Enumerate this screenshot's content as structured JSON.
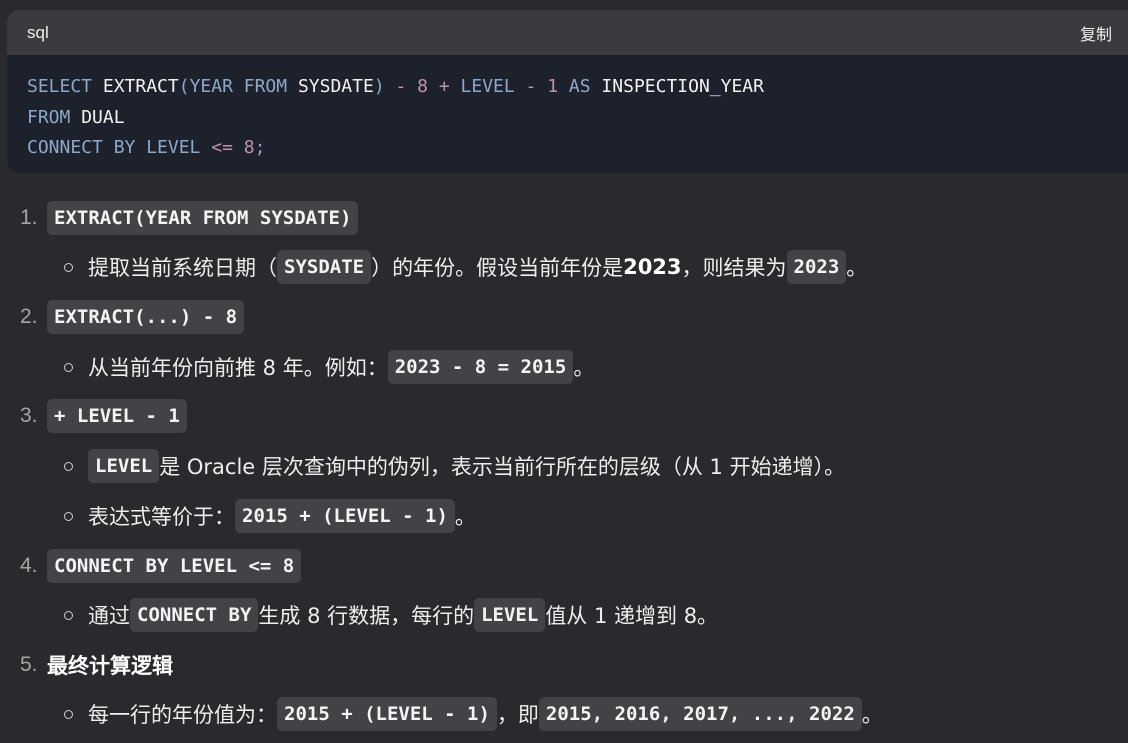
{
  "code_block": {
    "language": "sql",
    "copy_label": "复制",
    "line1": {
      "t1": "SELECT",
      "t2": " EXTRACT",
      "t3": "(",
      "t4": "YEAR FROM",
      "t5": " SYSDATE",
      "t6": ")",
      "t7": " - 8 + ",
      "t8": "LEVEL",
      "t9": " - 1 ",
      "t10": "AS",
      "t11": " INSPECTION_YEAR"
    },
    "line2": {
      "t1": "FROM",
      "t2": " DUAL"
    },
    "line3": {
      "t1": "CONNECT BY LEVEL",
      "t2": " <= 8",
      "t3": ";"
    }
  },
  "list": {
    "item1": {
      "num": "1.",
      "code": "EXTRACT(YEAR FROM SYSDATE)",
      "sub1": {
        "a": "提取当前系统日期（",
        "code": "SYSDATE",
        "b": "）的年份。假设当前年份是 ",
        "bold": "2023",
        "c": "，则结果为 ",
        "code2": "2023",
        "d": "。"
      }
    },
    "item2": {
      "num": "2.",
      "code": "EXTRACT(...) - 8",
      "sub1": {
        "a": "从当前年份向前推 8 年。例如：",
        "code": "2023 - 8 = 2015",
        "b": "。"
      }
    },
    "item3": {
      "num": "3.",
      "code": "+ LEVEL - 1",
      "sub1": {
        "code": "LEVEL",
        "a": " 是 Oracle 层次查询中的伪列，表示当前行所在的层级（从 1 开始递增）。"
      },
      "sub2": {
        "a": "表达式等价于：",
        "code": "2015 + (LEVEL - 1)",
        "b": "。"
      }
    },
    "item4": {
      "num": "4.",
      "code": "CONNECT BY LEVEL <= 8",
      "sub1": {
        "a": "通过 ",
        "code": "CONNECT BY",
        "b": " 生成 8 行数据，每行的 ",
        "code2": "LEVEL",
        "c": " 值从 1 递增到 8。"
      }
    },
    "item5": {
      "num": "5.",
      "title": "最终计算逻辑",
      "sub1": {
        "a": "每一行的年份值为：",
        "code": "2015 + (LEVEL - 1)",
        "b": "，即 ",
        "code2": "2015, 2016, 2017, ..., 2022",
        "c": "。"
      }
    }
  }
}
